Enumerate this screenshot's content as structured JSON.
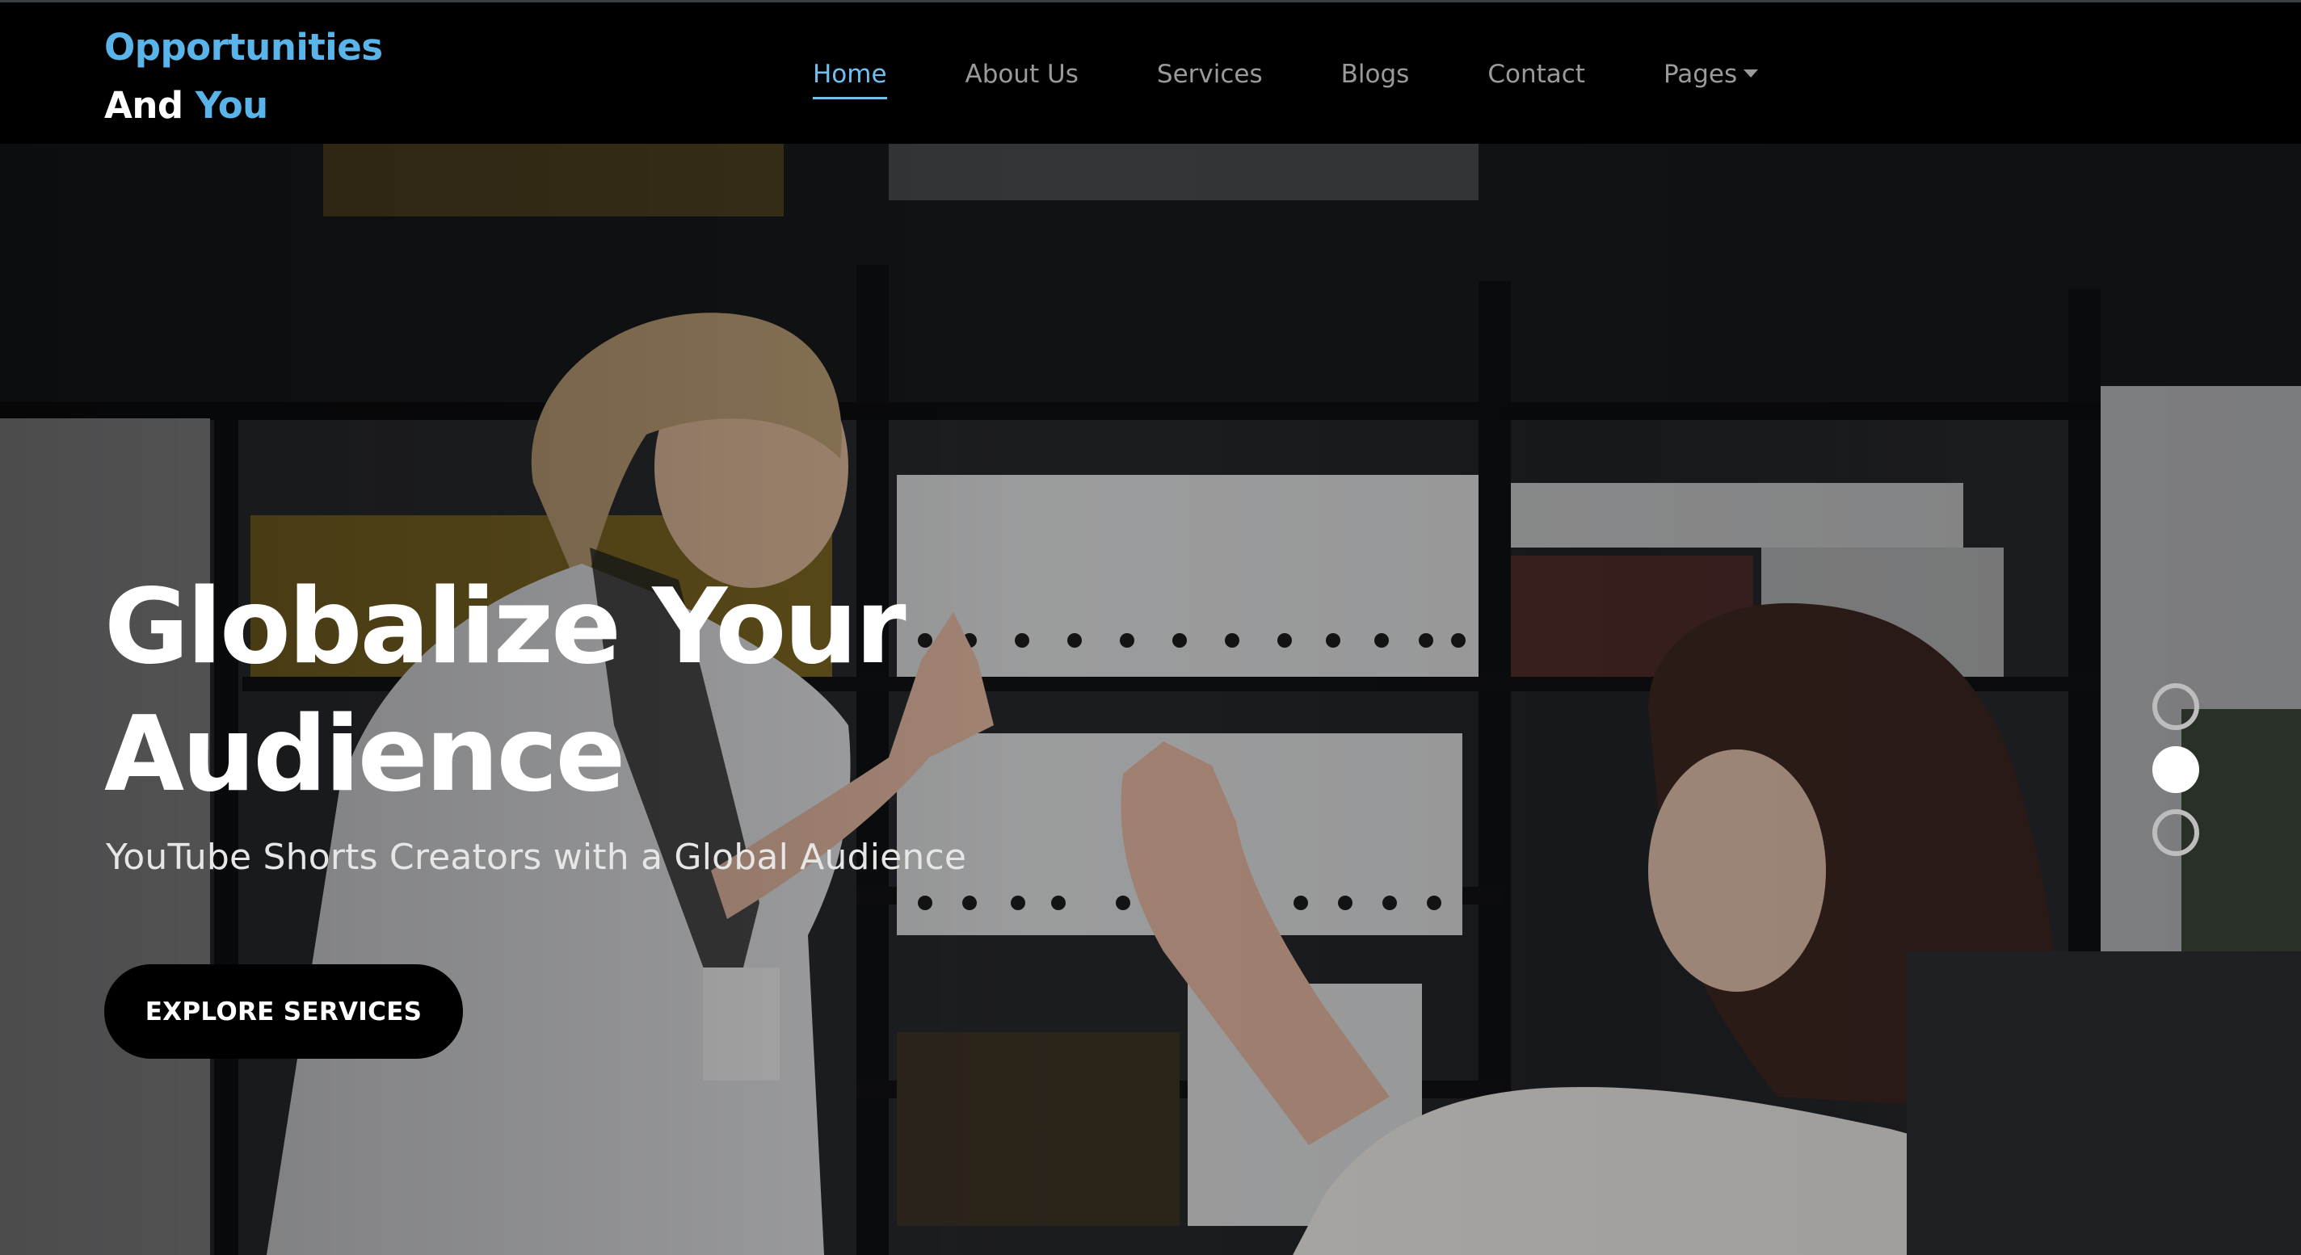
{
  "brand": {
    "line1": "Opportunities",
    "line2_part1": "And",
    "line2_part2": "You",
    "accent_color": "#5ab4ea"
  },
  "nav": {
    "items": [
      {
        "label": "Home",
        "active": true
      },
      {
        "label": "About Us",
        "active": false
      },
      {
        "label": "Services",
        "active": false
      },
      {
        "label": "Blogs",
        "active": false
      },
      {
        "label": "Contact",
        "active": false
      },
      {
        "label": "Pages",
        "active": false,
        "has_dropdown": true
      }
    ],
    "dropdown_icon": "caret-down-icon"
  },
  "hero": {
    "title_line1": "Globalize Your",
    "title_line2": "Audience",
    "subtitle": "YouTube Shorts Creators with a Global Audience",
    "cta_label": "EXPLORE SERVICES",
    "background_image": "office-high-five-photo",
    "slider": {
      "total_slides": 3,
      "active_index": 1
    }
  }
}
